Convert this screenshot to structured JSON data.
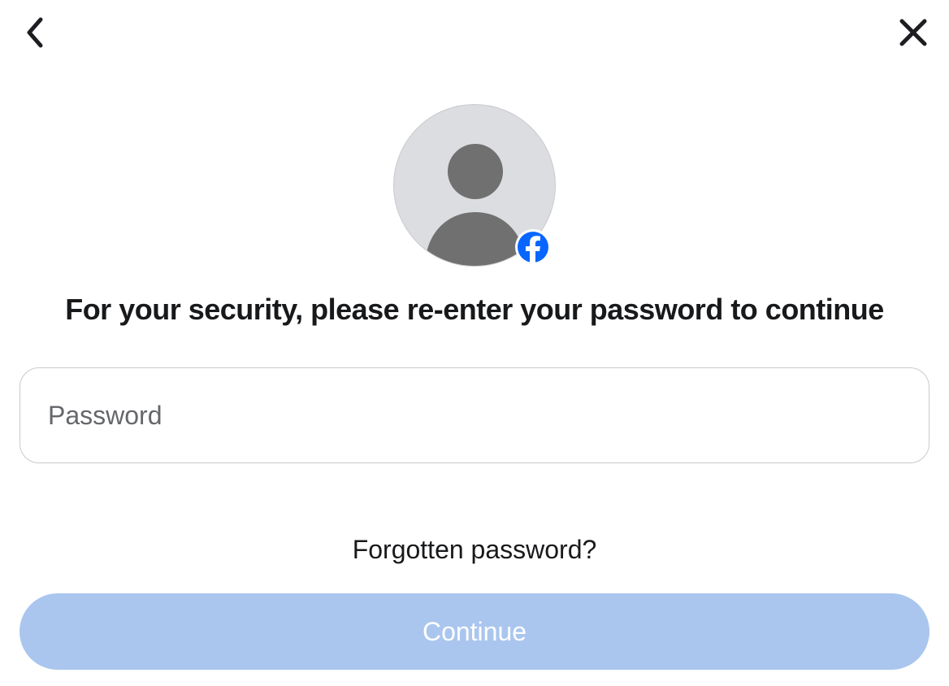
{
  "heading": "For your security, please re-enter your password to continue",
  "password": {
    "placeholder": "Password",
    "value": ""
  },
  "forgot_link": "Forgotten password?",
  "continue_label": "Continue",
  "colors": {
    "badge": "#0866ff",
    "button_bg": "#aac6ee",
    "avatar_bg": "#dcdde0"
  }
}
